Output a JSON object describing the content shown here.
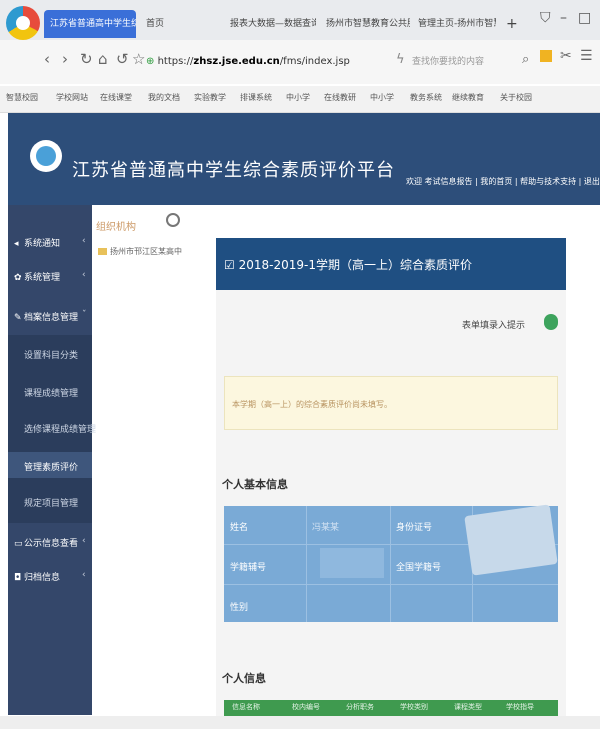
{
  "browser": {
    "tabs": [
      "江苏省普通高中学生综合",
      "首页",
      "报表大数据—数据查询",
      "扬州市智慧教育公共服务",
      "管理主页-扬州市智慧教",
      "+"
    ],
    "url_prefix": "https://",
    "url_host": "zhsz.jse.edu.cn",
    "url_path": "/fms/index.jsp",
    "search_hint": "查找你要找的内容",
    "bookmarks": [
      "智慧校园",
      "学校网站",
      "在线课堂",
      "我的文档",
      "实验教学",
      "排课系统",
      "中小学",
      "在线教研",
      "中小学",
      "教务系统",
      "继续教育",
      "关于校园"
    ]
  },
  "site": {
    "title": "江苏省普通高中学生综合素质评价平台",
    "header_links": "欢迎  考试信息报告  |  我的首页  |  帮助与技术支持  |  退出登录"
  },
  "sidebar": {
    "items": [
      {
        "label": "系统通知",
        "icon": "bell-icon"
      },
      {
        "label": "系统管理",
        "icon": "gear-icon"
      },
      {
        "label": "档案信息管理",
        "icon": "edit-icon"
      }
    ],
    "subitems": [
      "设置科目分类",
      "课程成绩管理",
      "选修课程成绩管理",
      "管理素质评价",
      "规定项目管理"
    ],
    "items_bottom": [
      {
        "label": "公示信息查看",
        "icon": "monitor-icon"
      },
      {
        "label": "归档信息",
        "icon": "lock-icon"
      }
    ]
  },
  "tree": {
    "title": "组织机构",
    "node": "扬州市邗江区某高中"
  },
  "panel": {
    "title": "2018-2019-1学期（高一上）综合素质评价",
    "toggle_label": "表单填录入提示",
    "notice": "本学期（高一上）的综合素质评价尚未填写。",
    "basic_heading": "个人基本信息",
    "basic_info": {
      "name_label": "姓名",
      "name_value": "冯某某",
      "idcard_label": "身份证号",
      "studentno_label": "学籍辅号",
      "national_no_label": "全国学籍号",
      "gender_label": "性别"
    },
    "info_heading": "个人信息",
    "info_columns": [
      "信息名称",
      "校内编号",
      "分析职务",
      "学校类别",
      "课程类型",
      "学校指导"
    ]
  },
  "colors": {
    "header_bg": "#2d4e7a",
    "sidebar_bg": "#34476a",
    "panel_header_bg": "#1f4f82",
    "table_bg": "#7aaad6",
    "toggle_on": "#3da35d"
  }
}
